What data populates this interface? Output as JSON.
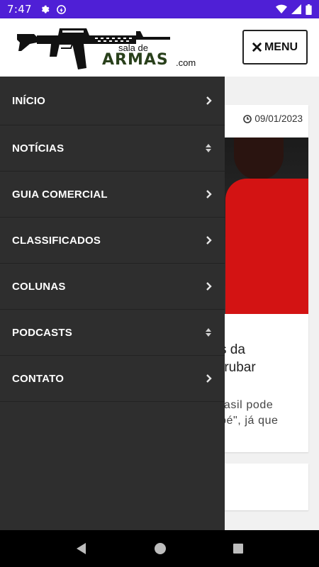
{
  "status_bar": {
    "time": "7:47",
    "bg_color": "#4f1fd6"
  },
  "header": {
    "logo": {
      "small_text": "sala de",
      "big_text": "ARMAS",
      "suffix": ".com"
    },
    "menu_button": {
      "icon": "close-icon",
      "label": "MENU"
    }
  },
  "drawer": {
    "items": [
      {
        "label": "INÍCIO",
        "indicator": "chevron-right-icon"
      },
      {
        "label": "NOTÍCIAS",
        "indicator": "sort-icon"
      },
      {
        "label": "GUIA COMERCIAL",
        "indicator": "chevron-right-icon"
      },
      {
        "label": "CLASSIFICADOS",
        "indicator": "chevron-right-icon"
      },
      {
        "label": "COLUNAS",
        "indicator": "chevron-right-icon"
      },
      {
        "label": "PODCASTS",
        "indicator": "sort-icon"
      },
      {
        "label": "CONTATO",
        "indicator": "chevron-right-icon"
      }
    ]
  },
  "article": {
    "date": "09/01/2023",
    "title_lines": [
      "s da",
      "rrubar"
    ],
    "excerpt_lines": [
      "rasil pode",
      "bé\", já que"
    ]
  },
  "navigation": {
    "back": "back-icon",
    "home": "home-icon",
    "recents": "recents-icon"
  }
}
